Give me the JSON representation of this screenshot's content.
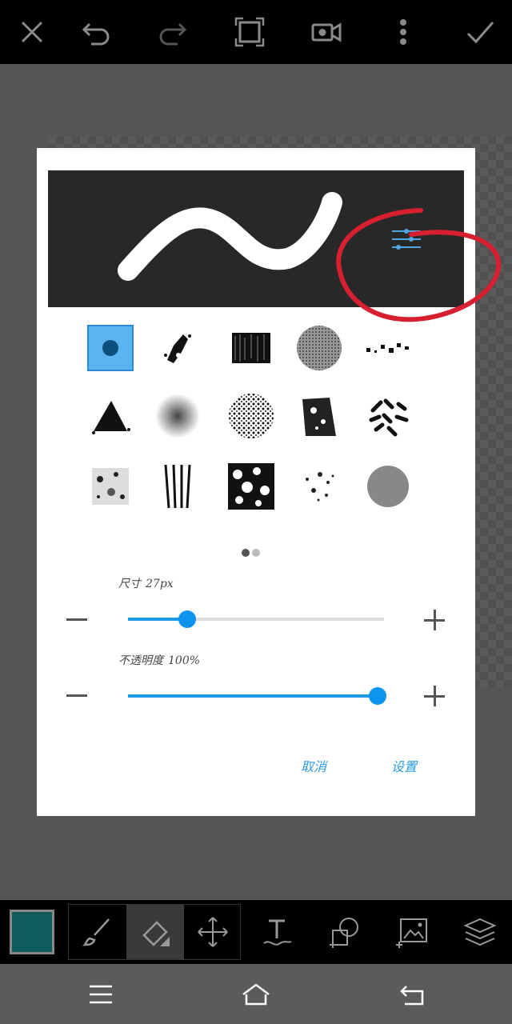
{
  "top_toolbar": {
    "icons": [
      "close-icon",
      "undo-icon",
      "redo-icon",
      "fullscreen-icon",
      "video-record-icon",
      "more-vertical-icon",
      "check-icon"
    ]
  },
  "brush_dialog": {
    "brushes": [
      "round-solid",
      "chalk-splatter",
      "charcoal-rough",
      "noise-circle",
      "dotted-scatter",
      "triangle-splat",
      "soft-airbrush",
      "speckle-circle",
      "rough-texture",
      "scribble-dashes",
      "grunge-square",
      "streak-lines",
      "camo-texture",
      "light-speckle",
      "flat-gray-circle"
    ],
    "selected_brush_index": 0,
    "page_indicator": {
      "pages": 2,
      "current": 1
    },
    "size": {
      "label": "尺寸",
      "value": "27px",
      "level": 0.23
    },
    "opacity": {
      "label": "不透明度",
      "value": "100%",
      "level": 1.0
    },
    "cancel_label": "取消",
    "set_label": "设置",
    "colors": {
      "accent": "#1e9be6",
      "annotation": "#d6202f"
    }
  },
  "bottom_toolbar": {
    "current_color": "#0d5b5b",
    "tools": [
      "brush-icon",
      "eraser-icon",
      "move-icon"
    ],
    "active_tool": "eraser-icon",
    "actions": [
      "text-icon",
      "shape-icon",
      "add-image-icon",
      "layers-icon"
    ]
  },
  "nav_bar": {
    "icons": [
      "menu-icon",
      "home-icon",
      "back-icon"
    ]
  }
}
